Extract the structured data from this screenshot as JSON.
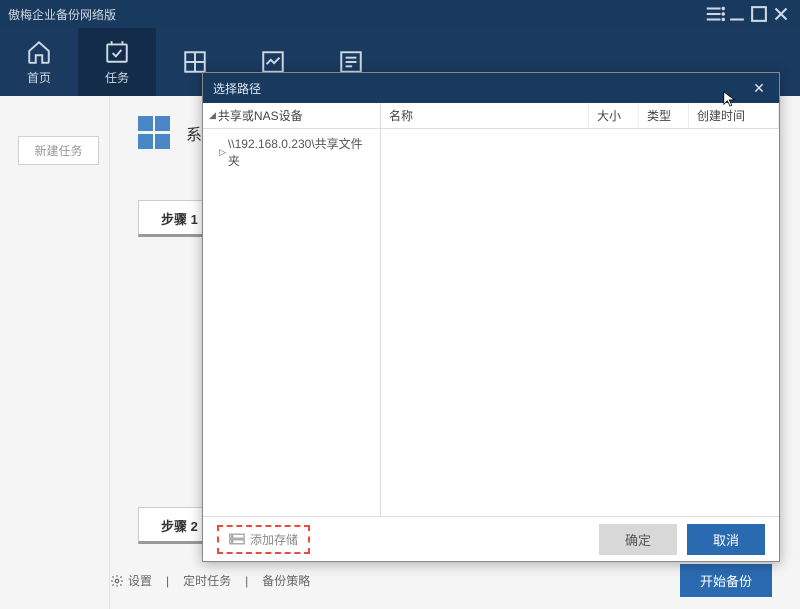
{
  "titlebar": {
    "title": "傲梅企业备份网络版"
  },
  "toolbar": {
    "home": "首页",
    "tasks": "任务"
  },
  "sidebar": {
    "newtask": "新建任务"
  },
  "content": {
    "system_label": "系",
    "step1": "步骤 1",
    "step2": "步骤 2"
  },
  "bottombar": {
    "settings": "设置",
    "schedule": "定时任务",
    "policy": "备份策略",
    "start_backup": "开始备份"
  },
  "dialog": {
    "title": "选择路径",
    "tree_header": "共享或NAS设备",
    "tree_item1": "\\\\192.168.0.230\\共享文件夹",
    "col_name": "名称",
    "col_size": "大小",
    "col_type": "类型",
    "col_time": "创建时间",
    "add_storage": "添加存储",
    "ok": "确定",
    "cancel": "取消"
  }
}
